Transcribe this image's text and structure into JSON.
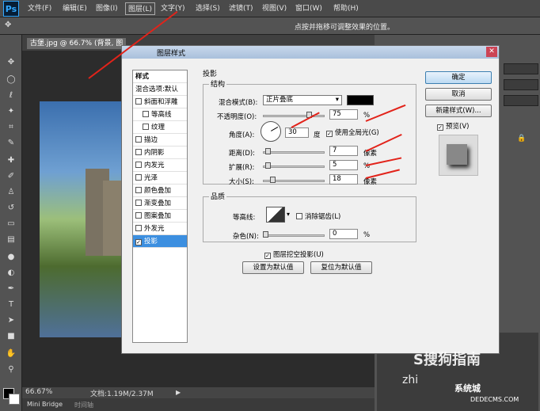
{
  "menubar": {
    "logo": "Ps",
    "items": [
      "文件(F)",
      "编辑(E)",
      "图像(I)",
      "图层(L)",
      "文字(Y)",
      "选择(S)",
      "滤镜(T)",
      "视图(V)",
      "窗口(W)",
      "帮助(H)"
    ]
  },
  "options_bar": {
    "hint": "点按并拖移可调整效果的位置。"
  },
  "document": {
    "tab": "古堡.jpg @ 66.7% (背景, 图",
    "zoom": "66.67%",
    "info": "文档:1.19M/2.37M"
  },
  "bottom_tabs": [
    "Mini Bridge",
    "时间轴"
  ],
  "dialog": {
    "title": "图层样式",
    "styles_header": "样式",
    "blend_options": "混合选项:默认",
    "styles": [
      {
        "label": "斜面和浮雕",
        "checked": false
      },
      {
        "label": "等高线",
        "checked": false
      },
      {
        "label": "纹理",
        "checked": false
      },
      {
        "label": "描边",
        "checked": false
      },
      {
        "label": "内阴影",
        "checked": false
      },
      {
        "label": "内发光",
        "checked": false
      },
      {
        "label": "光泽",
        "checked": false
      },
      {
        "label": "颜色叠加",
        "checked": false
      },
      {
        "label": "渐变叠加",
        "checked": false
      },
      {
        "label": "图案叠加",
        "checked": false
      },
      {
        "label": "外发光",
        "checked": false
      },
      {
        "label": "投影",
        "checked": true
      }
    ],
    "section_title": "投影",
    "structure": {
      "label": "结构",
      "blend_mode_label": "混合模式(B):",
      "blend_mode_value": "正片叠底",
      "shadow_color": "#000000",
      "opacity_label": "不透明度(O):",
      "opacity_value": "75",
      "opacity_unit": "%",
      "angle_label": "角度(A):",
      "angle_value": "30",
      "angle_unit": "度",
      "global_light_label": "使用全局光(G)",
      "global_light_checked": true,
      "distance_label": "距离(D):",
      "distance_value": "7",
      "distance_unit": "像素",
      "spread_label": "扩展(R):",
      "spread_value": "5",
      "spread_unit": "%",
      "size_label": "大小(S):",
      "size_value": "18",
      "size_unit": "像素"
    },
    "quality": {
      "label": "品质",
      "contour_label": "等高线:",
      "antialias_label": "消除锯齿(L)",
      "noise_label": "杂色(N):",
      "noise_value": "0",
      "noise_unit": "%"
    },
    "knockout_label": "图层挖空投影(U)",
    "knockout_checked": true,
    "set_default": "设置为默认值",
    "reset_default": "复位为默认值",
    "ok": "确定",
    "cancel": "取消",
    "new_style": "新建样式(W)...",
    "preview_label": "预览(V)",
    "preview_checked": true
  },
  "watermarks": {
    "sogou": "S搜狗指南",
    "zhi": "zhi",
    "system": "系统城",
    "site": "DEDECMS.COM"
  },
  "colors": {
    "annotation_arrow": "#e2231a",
    "selected_style": "#3c8fe0"
  }
}
